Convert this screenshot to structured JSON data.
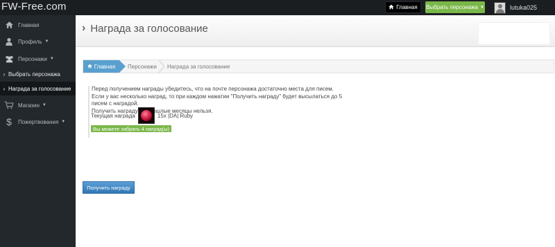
{
  "site": {
    "logo": "FW-Free.com"
  },
  "topbar": {
    "home_label": "Главная",
    "choose_character_label": "Выбрать персонажа",
    "username": "lutuka025"
  },
  "sidebar": {
    "items": [
      {
        "label": "Главная",
        "icon": "home-icon"
      },
      {
        "label": "Профиль",
        "icon": "user-icon",
        "has_dropdown": true
      },
      {
        "label": "Персонажи",
        "icon": "users-icon",
        "has_dropdown": true
      },
      {
        "label": "Выбрать персонажа",
        "sub": true
      },
      {
        "label": "Награда за голосование",
        "sub": true,
        "active": true
      },
      {
        "label": "Магазин",
        "icon": "cart-icon",
        "has_dropdown": true
      },
      {
        "label": "Пожертвования",
        "icon": "dollar-icon",
        "has_dropdown": true
      }
    ]
  },
  "header": {
    "title": "Награда за голосование"
  },
  "breadcrumb": {
    "items": [
      "Главная",
      "Персонажи",
      "Награда за голосование"
    ]
  },
  "content": {
    "notice_lines": [
      "Перед получением награды убедитесь, что на почте персонажа достаточно места для писем.",
      "Если у вас несколько наград, то при каждом нажатии \"Получить награду\" будет высылаться до 5 писем с наградой.",
      "Получить награду за прошлые месяцы нельзя."
    ],
    "current_reward_label": "Текущая награда",
    "reward_item": "15x |DA| Ruby",
    "badge_text": "Вы можете забрать 4 наград(ы)",
    "claim_button": "Получить награду"
  },
  "colors": {
    "topbar": "#1b1e21",
    "sidebar": "#23282d",
    "accent_green": "#7ab749",
    "accent_blue": "#5aa0cf"
  }
}
